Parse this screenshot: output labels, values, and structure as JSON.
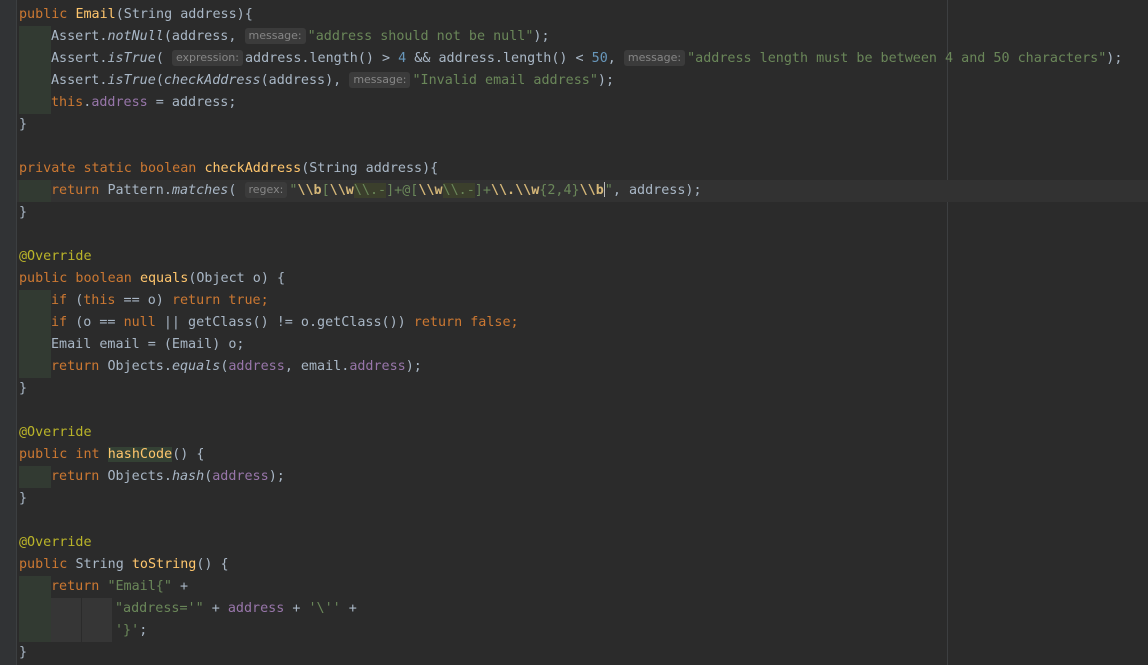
{
  "editor": {
    "colors": {
      "background": "#2b2b2b",
      "keyword": "#cc7832",
      "method_declaration": "#ffc66d",
      "string": "#6a8759",
      "field": "#9876aa",
      "number": "#6897bb",
      "annotation": "#bbb529",
      "plain": "#a9b7c6"
    },
    "hints": {
      "message": "message:",
      "expression": "expression:",
      "regex": "regex:"
    },
    "lines": {
      "l01": {
        "kw": "public ",
        "name": "Email",
        "rest": "(String address){"
      },
      "l02": {
        "cls": "Assert.",
        "call": "notNull",
        "args": "(address, ",
        "str": "\"address should not be null\"",
        "end": ");"
      },
      "l03": {
        "cls": "Assert.",
        "call": "isTrue",
        "p1": "( ",
        "a1": "address.length() > ",
        "n1": "4",
        "a2": " && address.length() < ",
        "n2": "50",
        "a3": ", ",
        "str": "\"address length must be between 4 and 50 characters\"",
        "end": ");"
      },
      "l04": {
        "cls": "Assert.",
        "call": "isTrue",
        "p1": "(",
        "a1": "checkAddress",
        "a2": "(address), ",
        "str": "\"Invalid email address\"",
        "end": ");"
      },
      "l05": {
        "kw": "this",
        "dot": ".",
        "fld": "address",
        "rest": " = address;"
      },
      "l06": {
        "text": "}"
      },
      "l08": {
        "kw": "private static boolean ",
        "name": "checkAddress",
        "rest": "(String address){"
      },
      "l09": {
        "kw": "return ",
        "cls": "Pattern.",
        "call": "matches",
        "p1": "( ",
        "q1": "\"",
        "r1": "\\\\b",
        "r2": "[",
        "r3": "\\\\w",
        "r4": "\\\\.-",
        "r5": "]+@[",
        "r6": "\\\\w",
        "r7": "\\\\.-",
        "r8": "]+",
        "r9": "\\\\.\\\\w",
        "r10": "{2,4}",
        "r11": "\\\\b",
        "q2": "\"",
        "rest": ", address);"
      },
      "l10": {
        "text": "}"
      },
      "l12": {
        "text": "@Override"
      },
      "l13": {
        "kw": "public boolean ",
        "name": "equals",
        "rest": "(Object o) {"
      },
      "l14": {
        "kw1": "if ",
        "p": "(",
        "kw2": "this",
        "mid": " == o) ",
        "kw3": "return true",
        "end": ";"
      },
      "l15": {
        "kw1": "if ",
        "mid": "(o == ",
        "kw2": "null",
        "mid2": " || getClass() != o.getClass()) ",
        "kw3": "return false",
        "end": ";"
      },
      "l16": {
        "text": "Email email = (Email) o;"
      },
      "l17": {
        "kw": "return ",
        "cls": "Objects.",
        "call": "equals",
        "p": "(",
        "fld1": "address",
        "mid": ", email.",
        "fld2": "address",
        "end": ");"
      },
      "l18": {
        "text": "}"
      },
      "l20": {
        "text": "@Override"
      },
      "l21": {
        "kw": "public int ",
        "name": "hashCode",
        "rest": "() {"
      },
      "l22": {
        "kw": "return ",
        "cls": "Objects.",
        "call": "hash",
        "p": "(",
        "fld": "address",
        "end": ");"
      },
      "l23": {
        "text": "}"
      },
      "l25": {
        "text": "@Override"
      },
      "l26": {
        "kw": "public ",
        "type": "String ",
        "name": "toString",
        "rest": "() {"
      },
      "l27": {
        "kw": "return ",
        "str": "\"Email{\"",
        "rest": " +"
      },
      "l28": {
        "str1": "\"address='\"",
        "mid": " + ",
        "fld": "address",
        "mid2": " + ",
        "str2": "'\\''",
        "end": " +"
      },
      "l29": {
        "str": "'}'",
        "end": ";"
      },
      "l30": {
        "text": "}"
      }
    }
  }
}
